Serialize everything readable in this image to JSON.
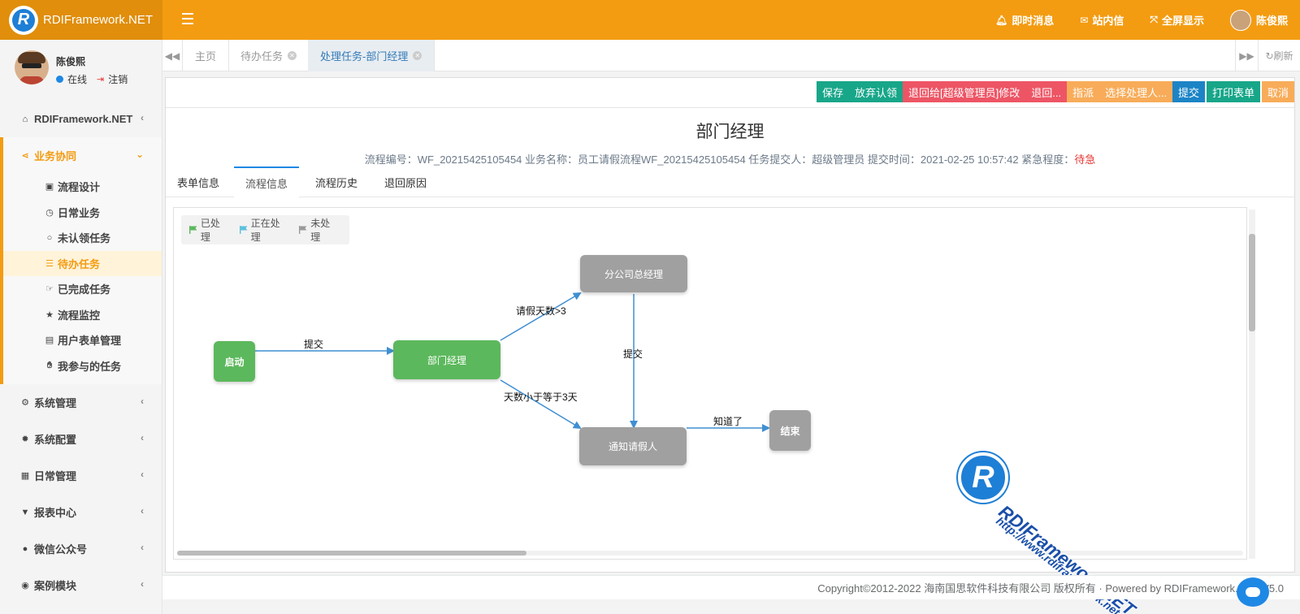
{
  "app": {
    "name": "RDIFramework.NET",
    "logo_letter": "R"
  },
  "header": {
    "instant_message": "即时消息",
    "internal_mail": "站内信",
    "fullscreen": "全屏显示",
    "user": "陈俊熙"
  },
  "sidebar": {
    "user_name": "陈俊熙",
    "status": "在线",
    "logout": "注销",
    "items": [
      {
        "label": "RDIFramework.NET",
        "icon": "home-icon"
      },
      {
        "label": "业务协同",
        "icon": "share-icon",
        "expanded": true
      },
      {
        "label": "系统管理",
        "icon": "cogs-icon"
      },
      {
        "label": "系统配置",
        "icon": "gear-icon"
      },
      {
        "label": "日常管理",
        "icon": "calendar-icon"
      },
      {
        "label": "报表中心",
        "icon": "filter-icon"
      },
      {
        "label": "微信公众号",
        "icon": "wechat-icon"
      },
      {
        "label": "案例模块",
        "icon": "eye-icon"
      }
    ],
    "sub_items": [
      {
        "label": "流程设计",
        "icon": "edit-icon"
      },
      {
        "label": "日常业务",
        "icon": "clock-icon"
      },
      {
        "label": "未认领任务",
        "icon": "circle-icon"
      },
      {
        "label": "待办任务",
        "icon": "list-icon",
        "active": true
      },
      {
        "label": "已完成任务",
        "icon": "hand-icon"
      },
      {
        "label": "流程监控",
        "icon": "star-icon"
      },
      {
        "label": "用户表单管理",
        "icon": "keyboard-icon"
      },
      {
        "label": "我参与的任务",
        "icon": "hand-paper-icon"
      }
    ]
  },
  "tabs": [
    {
      "label": "主页",
      "closable": false
    },
    {
      "label": "待办任务",
      "closable": true
    },
    {
      "label": "处理任务-部门经理",
      "closable": true,
      "active": true
    }
  ],
  "tab_refresh": "刷新",
  "toolbar": [
    {
      "label": "保存",
      "color": "green"
    },
    {
      "label": "放弃认领",
      "color": "green"
    },
    {
      "label": "退回给[超级管理员]修改",
      "color": "red"
    },
    {
      "label": "退回...",
      "color": "red"
    },
    {
      "label": "指派",
      "color": "orange"
    },
    {
      "label": "选择处理人...",
      "color": "orange"
    },
    {
      "label": "提交",
      "color": "blue"
    },
    {
      "label": "打印表单",
      "color": "green"
    },
    {
      "label": "取消",
      "color": "orange"
    }
  ],
  "document": {
    "title": "部门经理",
    "meta": "流程编号：WF_20215425105454 业务名称：员工请假流程WF_20215425105454 任务提交人：超级管理员 提交时间：2021-02-25 10:57:42 紧急程度：",
    "urgency": "待急"
  },
  "inner_tabs": [
    {
      "label": "表单信息"
    },
    {
      "label": "流程信息",
      "active": true
    },
    {
      "label": "流程历史"
    },
    {
      "label": "退回原因"
    }
  ],
  "legend": [
    {
      "label": "已处理",
      "color": "#5cb85c"
    },
    {
      "label": "正在处理",
      "color": "#5bc0de"
    },
    {
      "label": "未处理",
      "color": "#999999"
    }
  ],
  "flow": {
    "nodes": {
      "start": "启动",
      "dept_manager": "部门经理",
      "branch_gm": "分公司总经理",
      "notify": "通知请假人",
      "end": "结束"
    },
    "edges": {
      "submit1": "提交",
      "days_gt3": "请假天数>3",
      "days_le3": "天数小于等于3天",
      "submit2": "提交",
      "known": "知道了"
    }
  },
  "watermark": {
    "letter": "R",
    "line1": "RDIFramework.NET",
    "line2": "http://www.rdiframework.net"
  },
  "footer": {
    "text": "Copyright©2012-2022 海南国思软件科技有限公司 版权所有 · Powered by RDIFramework.NET-V5.0"
  }
}
